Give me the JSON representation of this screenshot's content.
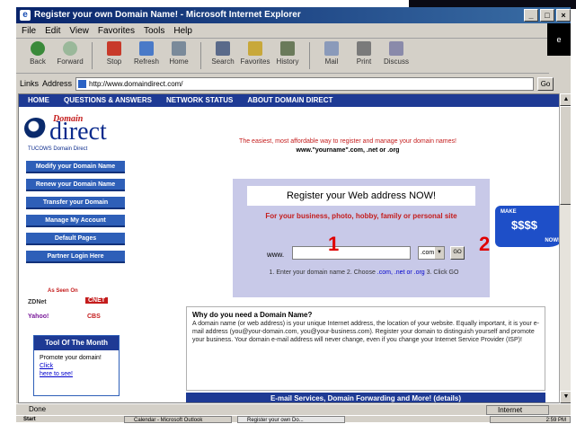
{
  "window": {
    "title": "Register your own Domain Name! - Microsoft Internet Explorer",
    "buttons": [
      "_",
      "□",
      "×"
    ]
  },
  "menu": [
    "File",
    "Edit",
    "View",
    "Favorites",
    "Tools",
    "Help"
  ],
  "toolbar": [
    {
      "label": "Back",
      "icon": "back-arrow-icon"
    },
    {
      "label": "Forward",
      "icon": "forward-arrow-icon"
    },
    {
      "label": "Stop",
      "icon": "stop-icon"
    },
    {
      "label": "Refresh",
      "icon": "refresh-icon"
    },
    {
      "label": "Home",
      "icon": "home-icon"
    },
    {
      "label": "Search",
      "icon": "search-icon"
    },
    {
      "label": "Favorites",
      "icon": "favorites-icon"
    },
    {
      "label": "History",
      "icon": "history-icon"
    },
    {
      "label": "Mail",
      "icon": "mail-icon"
    },
    {
      "label": "Print",
      "icon": "print-icon"
    },
    {
      "label": "Discuss",
      "icon": "discuss-icon"
    }
  ],
  "address": {
    "links_label": "Links",
    "address_label": "Address",
    "url": "http://www.domaindirect.com/",
    "go_label": "Go"
  },
  "site_nav": [
    "HOME",
    "QUESTIONS & ANSWERS",
    "NETWORK STATUS",
    "ABOUT DOMAIN DIRECT"
  ],
  "logo": {
    "domain": "Domain",
    "direct": "direct",
    "tagline": "TUCOWS Domain Direct"
  },
  "sidebar_links": [
    "Modify your Domain Name",
    "Renew your Domain Name",
    "Transfer your Domain",
    "Manage My Account",
    "Default Pages",
    "Partner Login Here"
  ],
  "as_seen": "As Seen On",
  "media": [
    "ZDNet",
    "CNET",
    "Yahoo!",
    "CBS"
  ],
  "tool_of_month": {
    "header": "Tool Of The Month",
    "text": "Promote your domain!",
    "link1": "Click",
    "link2": "here to see!"
  },
  "intro": {
    "red": "The easiest, most affordable way to register and manage your domain names!",
    "bold": "www.\"yourname\".com, .net or .org"
  },
  "register": {
    "title": "Register your Web address NOW!",
    "subtitle": "For your business, photo, hobby, family or personal site",
    "www_label": "www.",
    "tld_value": ".com",
    "go_label": "GO",
    "steps_prefix": "1. Enter your domain name 2. Choose ",
    "steps_links": ".com, .net or .org",
    "steps_suffix": " 3. Click GO"
  },
  "markers": [
    "1",
    "2"
  ],
  "make_money": {
    "line1": "MAKE",
    "line2": "$$$$",
    "line3": "NOW!"
  },
  "why": {
    "question": "Why do you need a Domain Name?",
    "text": "A domain name (or web address) is your unique Internet address, the location of your website. Equally important, it is your e-mail address (you@your-domain.com, you@your-business.com). Register your domain to distinguish yourself and promote your business. Your domain e-mail address will never change, even if you change your Internet Service Provider (ISP)!"
  },
  "banner": "E-mail Services, Domain Forwarding and More! (details)",
  "status": {
    "text": "Done",
    "zone": "Internet"
  },
  "taskbar": {
    "start": "Start",
    "tasks": [
      "Calendar - Microsoft Outlook",
      "Register your own Do..."
    ],
    "clock": "2:59 PM"
  },
  "colors": {
    "title_bar": "#08246b",
    "nav_blue": "#1e3a94",
    "register_box": "#c8c9e8",
    "marker_red": "#e00000",
    "accent_red": "#c41c1c"
  }
}
